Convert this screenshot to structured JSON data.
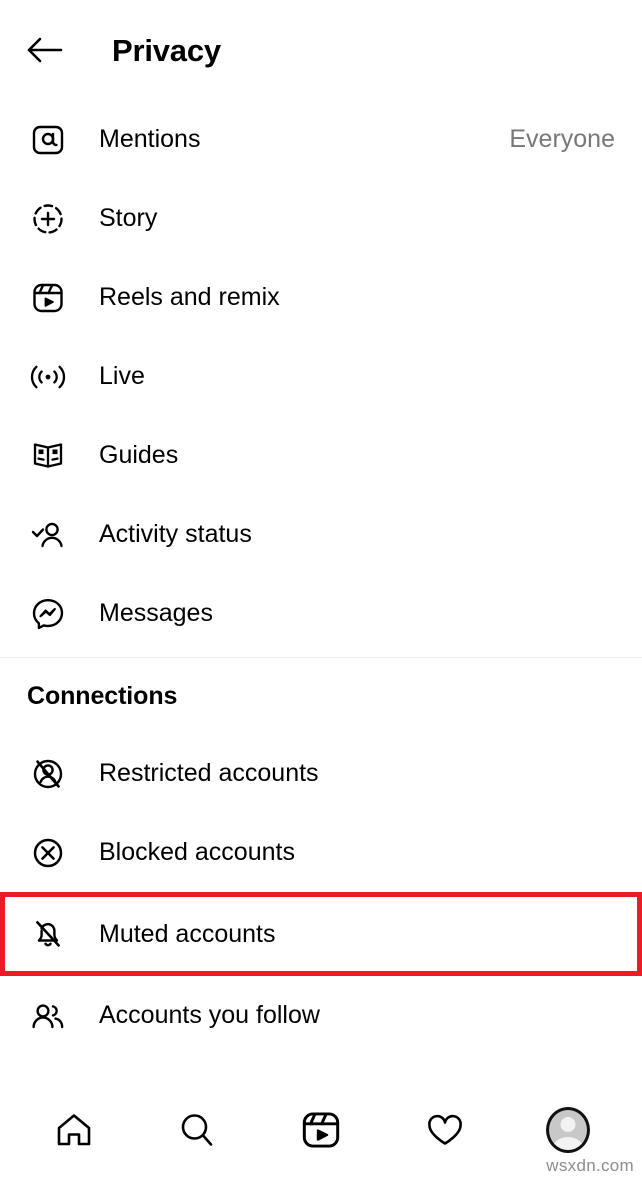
{
  "header": {
    "title": "Privacy",
    "back_icon": "arrow-left-icon"
  },
  "privacy_section": {
    "items": [
      {
        "label": "Mentions",
        "icon": "mention-at-icon",
        "value": "Everyone"
      },
      {
        "label": "Story",
        "icon": "story-plus-icon",
        "value": ""
      },
      {
        "label": "Reels and remix",
        "icon": "reels-icon",
        "value": ""
      },
      {
        "label": "Live",
        "icon": "live-broadcast-icon",
        "value": ""
      },
      {
        "label": "Guides",
        "icon": "guides-book-icon",
        "value": ""
      },
      {
        "label": "Activity status",
        "icon": "activity-status-icon",
        "value": ""
      },
      {
        "label": "Messages",
        "icon": "messenger-icon",
        "value": ""
      }
    ]
  },
  "connections_section": {
    "title": "Connections",
    "items": [
      {
        "label": "Restricted accounts",
        "icon": "restricted-accounts-icon",
        "highlighted": false
      },
      {
        "label": "Blocked accounts",
        "icon": "blocked-accounts-icon",
        "highlighted": false
      },
      {
        "label": "Muted accounts",
        "icon": "muted-bell-icon",
        "highlighted": true
      },
      {
        "label": "Accounts you follow",
        "icon": "accounts-you-follow-icon",
        "highlighted": false
      }
    ]
  },
  "bottom_nav": {
    "items": [
      {
        "icon": "home-icon",
        "label": "Home"
      },
      {
        "icon": "search-icon",
        "label": "Search"
      },
      {
        "icon": "reels-icon",
        "label": "Reels"
      },
      {
        "icon": "heart-icon",
        "label": "Activity"
      },
      {
        "icon": "profile-avatar",
        "label": "Profile"
      }
    ]
  },
  "watermark": {
    "text": "wsxdn.com"
  },
  "colors": {
    "highlight": "#ed1c24",
    "value_text": "#77787b",
    "divider": "#efefef",
    "background": "#ffffff",
    "foreground": "#000000"
  }
}
